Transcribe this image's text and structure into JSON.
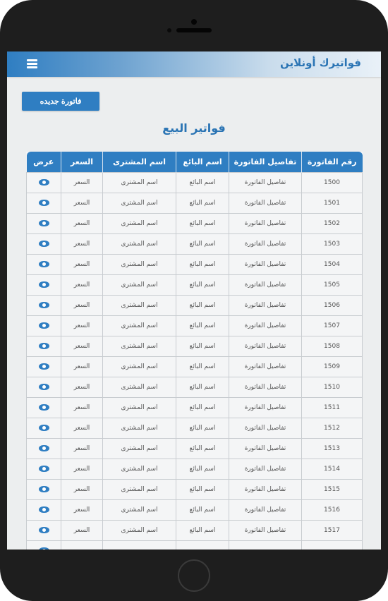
{
  "header": {
    "app_title": "فواتيرك أونلاين"
  },
  "actions": {
    "new_invoice_label": "فاتورة جديده"
  },
  "page": {
    "title": "فواتير البيع"
  },
  "table": {
    "columns": [
      "رقم الفاتورة",
      "تفاصيل الفاتورة",
      "اسم البائع",
      "اسم المشترى",
      "السعر",
      "عرض"
    ],
    "rows": [
      {
        "invoice_no": "1500",
        "details": "تفاصيل الفاتورة",
        "seller": "اسم البائع",
        "buyer": "اسم المشترى",
        "price": "السعر"
      },
      {
        "invoice_no": "1501",
        "details": "تفاصيل الفاتورة",
        "seller": "اسم البائع",
        "buyer": "اسم المشترى",
        "price": "السعر"
      },
      {
        "invoice_no": "1502",
        "details": "تفاصيل الفاتورة",
        "seller": "اسم البائع",
        "buyer": "اسم المشترى",
        "price": "السعر"
      },
      {
        "invoice_no": "1503",
        "details": "تفاصيل الفاتورة",
        "seller": "اسم البائع",
        "buyer": "اسم المشترى",
        "price": "السعر"
      },
      {
        "invoice_no": "1504",
        "details": "تفاصيل الفاتورة",
        "seller": "اسم البائع",
        "buyer": "اسم المشترى",
        "price": "السعر"
      },
      {
        "invoice_no": "1505",
        "details": "تفاصيل الفاتورة",
        "seller": "اسم البائع",
        "buyer": "اسم المشترى",
        "price": "السعر"
      },
      {
        "invoice_no": "1506",
        "details": "تفاصيل الفاتورة",
        "seller": "اسم البائع",
        "buyer": "اسم المشترى",
        "price": "السعر"
      },
      {
        "invoice_no": "1507",
        "details": "تفاصيل الفاتورة",
        "seller": "اسم البائع",
        "buyer": "اسم المشترى",
        "price": "السعر"
      },
      {
        "invoice_no": "1508",
        "details": "تفاصيل الفاتورة",
        "seller": "اسم البائع",
        "buyer": "اسم المشترى",
        "price": "السعر"
      },
      {
        "invoice_no": "1509",
        "details": "تفاصيل الفاتورة",
        "seller": "اسم البائع",
        "buyer": "اسم المشترى",
        "price": "السعر"
      },
      {
        "invoice_no": "1510",
        "details": "تفاصيل الفاتورة",
        "seller": "اسم البائع",
        "buyer": "اسم المشترى",
        "price": "السعر"
      },
      {
        "invoice_no": "1511",
        "details": "تفاصيل الفاتورة",
        "seller": "اسم البائع",
        "buyer": "اسم المشترى",
        "price": "السعر"
      },
      {
        "invoice_no": "1512",
        "details": "تفاصيل الفاتورة",
        "seller": "اسم البائع",
        "buyer": "اسم المشترى",
        "price": "السعر"
      },
      {
        "invoice_no": "1513",
        "details": "تفاصيل الفاتورة",
        "seller": "اسم البائع",
        "buyer": "اسم المشترى",
        "price": "السعر"
      },
      {
        "invoice_no": "1514",
        "details": "تفاصيل الفاتورة",
        "seller": "اسم البائع",
        "buyer": "اسم المشترى",
        "price": "السعر"
      },
      {
        "invoice_no": "1515",
        "details": "تفاصيل الفاتورة",
        "seller": "اسم البائع",
        "buyer": "اسم المشترى",
        "price": "السعر"
      },
      {
        "invoice_no": "1516",
        "details": "تفاصيل الفاتورة",
        "seller": "اسم البائع",
        "buyer": "اسم المشترى",
        "price": "السعر"
      },
      {
        "invoice_no": "1517",
        "details": "تفاصيل الفاتورة",
        "seller": "اسم البائع",
        "buyer": "اسم المشترى",
        "price": "السعر"
      },
      {
        "invoice_no": "",
        "details": "",
        "seller": "",
        "buyer": "",
        "price": ""
      }
    ]
  },
  "icons": {
    "menu": "hamburger-menu-icon",
    "view": "eye-icon"
  },
  "colors": {
    "accent": "#2f7ec2",
    "title": "#2a74b4",
    "background": "#eceeef",
    "device": "#1e1e1e"
  }
}
